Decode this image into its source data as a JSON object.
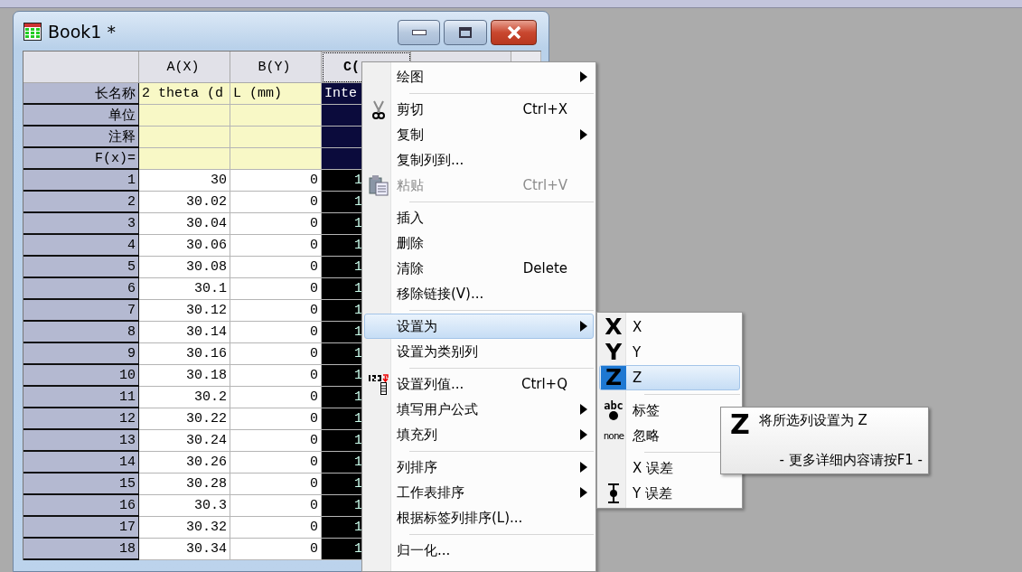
{
  "window": {
    "title": "Book1 *"
  },
  "table": {
    "columns": [
      {
        "label": "A(X)",
        "selected": false
      },
      {
        "label": "B(Y)",
        "selected": false
      },
      {
        "label": "C(",
        "selected": true
      }
    ],
    "meta_rows": [
      {
        "label": "长名称",
        "values": [
          "2 theta (d",
          "L (mm)",
          "Inte"
        ]
      },
      {
        "label": "单位"
      },
      {
        "label": "注释"
      },
      {
        "label": "F(x)="
      }
    ],
    "rows": [
      {
        "index": "1",
        "values": [
          "30",
          "0",
          "1"
        ]
      },
      {
        "index": "2",
        "values": [
          "30.02",
          "0",
          "1"
        ]
      },
      {
        "index": "3",
        "values": [
          "30.04",
          "0",
          "1"
        ]
      },
      {
        "index": "4",
        "values": [
          "30.06",
          "0",
          "1"
        ]
      },
      {
        "index": "5",
        "values": [
          "30.08",
          "0",
          "1"
        ]
      },
      {
        "index": "6",
        "values": [
          "30.1",
          "0",
          "1"
        ]
      },
      {
        "index": "7",
        "values": [
          "30.12",
          "0",
          "1"
        ]
      },
      {
        "index": "8",
        "values": [
          "30.14",
          "0",
          "1"
        ]
      },
      {
        "index": "9",
        "values": [
          "30.16",
          "0",
          "1"
        ]
      },
      {
        "index": "10",
        "values": [
          "30.18",
          "0",
          "1"
        ]
      },
      {
        "index": "11",
        "values": [
          "30.2",
          "0",
          "1"
        ]
      },
      {
        "index": "12",
        "values": [
          "30.22",
          "0",
          "1"
        ]
      },
      {
        "index": "13",
        "values": [
          "30.24",
          "0",
          "1"
        ]
      },
      {
        "index": "14",
        "values": [
          "30.26",
          "0",
          "1"
        ]
      },
      {
        "index": "15",
        "values": [
          "30.28",
          "0",
          "1"
        ]
      },
      {
        "index": "16",
        "values": [
          "30.3",
          "0",
          "1"
        ]
      },
      {
        "index": "17",
        "values": [
          "30.32",
          "0",
          "1"
        ]
      },
      {
        "index": "18",
        "values": [
          "30.34",
          "0",
          "1"
        ]
      }
    ]
  },
  "context_menu": {
    "items": [
      {
        "kind": "item",
        "label": "绘图",
        "submenu": true,
        "disabled": false,
        "selected": false
      },
      {
        "kind": "separator"
      },
      {
        "kind": "item",
        "label": "剪切",
        "shortcut": "Ctrl+X",
        "submenu": false,
        "disabled": false,
        "selected": false
      },
      {
        "kind": "item",
        "label": "复制",
        "submenu": true,
        "disabled": false,
        "selected": false
      },
      {
        "kind": "item",
        "label": "复制列到...",
        "submenu": false,
        "disabled": false,
        "selected": false
      },
      {
        "kind": "item",
        "label": "粘贴",
        "shortcut": "Ctrl+V",
        "submenu": false,
        "disabled": true,
        "selected": false
      },
      {
        "kind": "separator"
      },
      {
        "kind": "item",
        "label": "插入",
        "submenu": false,
        "disabled": false,
        "selected": false
      },
      {
        "kind": "item",
        "label": "删除",
        "submenu": false,
        "disabled": false,
        "selected": false
      },
      {
        "kind": "item",
        "label": "清除",
        "shortcut": "Delete",
        "submenu": false,
        "disabled": false,
        "selected": false
      },
      {
        "kind": "item",
        "label": "移除链接(V)...",
        "submenu": false,
        "disabled": false,
        "selected": false
      },
      {
        "kind": "separator"
      },
      {
        "kind": "item",
        "label": "设置为",
        "submenu": true,
        "disabled": false,
        "selected": true
      },
      {
        "kind": "item",
        "label": "设置为类别列",
        "submenu": false,
        "disabled": false,
        "selected": false
      },
      {
        "kind": "separator"
      },
      {
        "kind": "item",
        "label": "设置列值...",
        "shortcut": "Ctrl+Q",
        "submenu": false,
        "disabled": false,
        "selected": false
      },
      {
        "kind": "item",
        "label": "填写用户公式",
        "submenu": true,
        "disabled": false,
        "selected": false
      },
      {
        "kind": "item",
        "label": "填充列",
        "submenu": true,
        "disabled": false,
        "selected": false
      },
      {
        "kind": "separator"
      },
      {
        "kind": "item",
        "label": "列排序",
        "submenu": true,
        "disabled": false,
        "selected": false
      },
      {
        "kind": "item",
        "label": "工作表排序",
        "submenu": true,
        "disabled": false,
        "selected": false
      },
      {
        "kind": "item",
        "label": "根据标签列排序(L)...",
        "submenu": false,
        "disabled": false,
        "selected": false
      },
      {
        "kind": "separator"
      },
      {
        "kind": "item",
        "label": "归一化...",
        "submenu": false,
        "disabled": false,
        "selected": false
      }
    ]
  },
  "submenu": {
    "items": [
      {
        "kind": "letter",
        "glyph": "X",
        "label": "X",
        "selected": false
      },
      {
        "kind": "letter",
        "glyph": "Y",
        "label": "Y",
        "selected": false
      },
      {
        "kind": "letter",
        "glyph": "Z",
        "label": "Z",
        "selected": true
      },
      {
        "kind": "separator"
      },
      {
        "kind": "abc",
        "glyph": "abc",
        "label": "标签",
        "selected": false
      },
      {
        "kind": "word",
        "glyph": "none",
        "label": "忽略",
        "selected": false
      },
      {
        "kind": "separator"
      },
      {
        "kind": "blank",
        "label": "X 误差",
        "selected": false
      },
      {
        "kind": "errorbar",
        "label": "Y 误差",
        "selected": false
      }
    ]
  },
  "tooltip": {
    "glyph": "Z",
    "text": "将所选列设置为 Z",
    "hint": "- 更多详细内容请按F1 -"
  }
}
